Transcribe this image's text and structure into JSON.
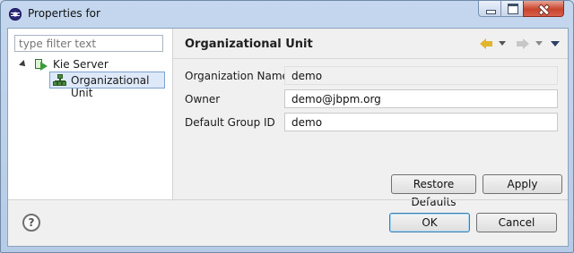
{
  "window": {
    "title": "Properties for",
    "minimize_label": "",
    "maximize_label": "",
    "close_label": ""
  },
  "filter": {
    "placeholder": "type filter text"
  },
  "tree": {
    "root_label": "Kie Server",
    "child_label": "Organizational Unit"
  },
  "page": {
    "title": "Organizational Unit"
  },
  "form": {
    "org_name_label": "Organization Name",
    "org_name_value": "demo",
    "owner_label": "Owner",
    "owner_value": "demo@jbpm.org",
    "group_id_label": "Default Group ID",
    "group_id_value": "demo"
  },
  "buttons": {
    "restore_defaults": "Restore Defaults",
    "apply": "Apply",
    "ok": "OK",
    "cancel": "Cancel"
  },
  "help": {
    "glyph": "?"
  },
  "icons": {
    "app": "eclipse-icon",
    "back": "back-arrow-icon",
    "forward": "forward-arrow-icon",
    "menu": "view-menu-icon"
  }
}
